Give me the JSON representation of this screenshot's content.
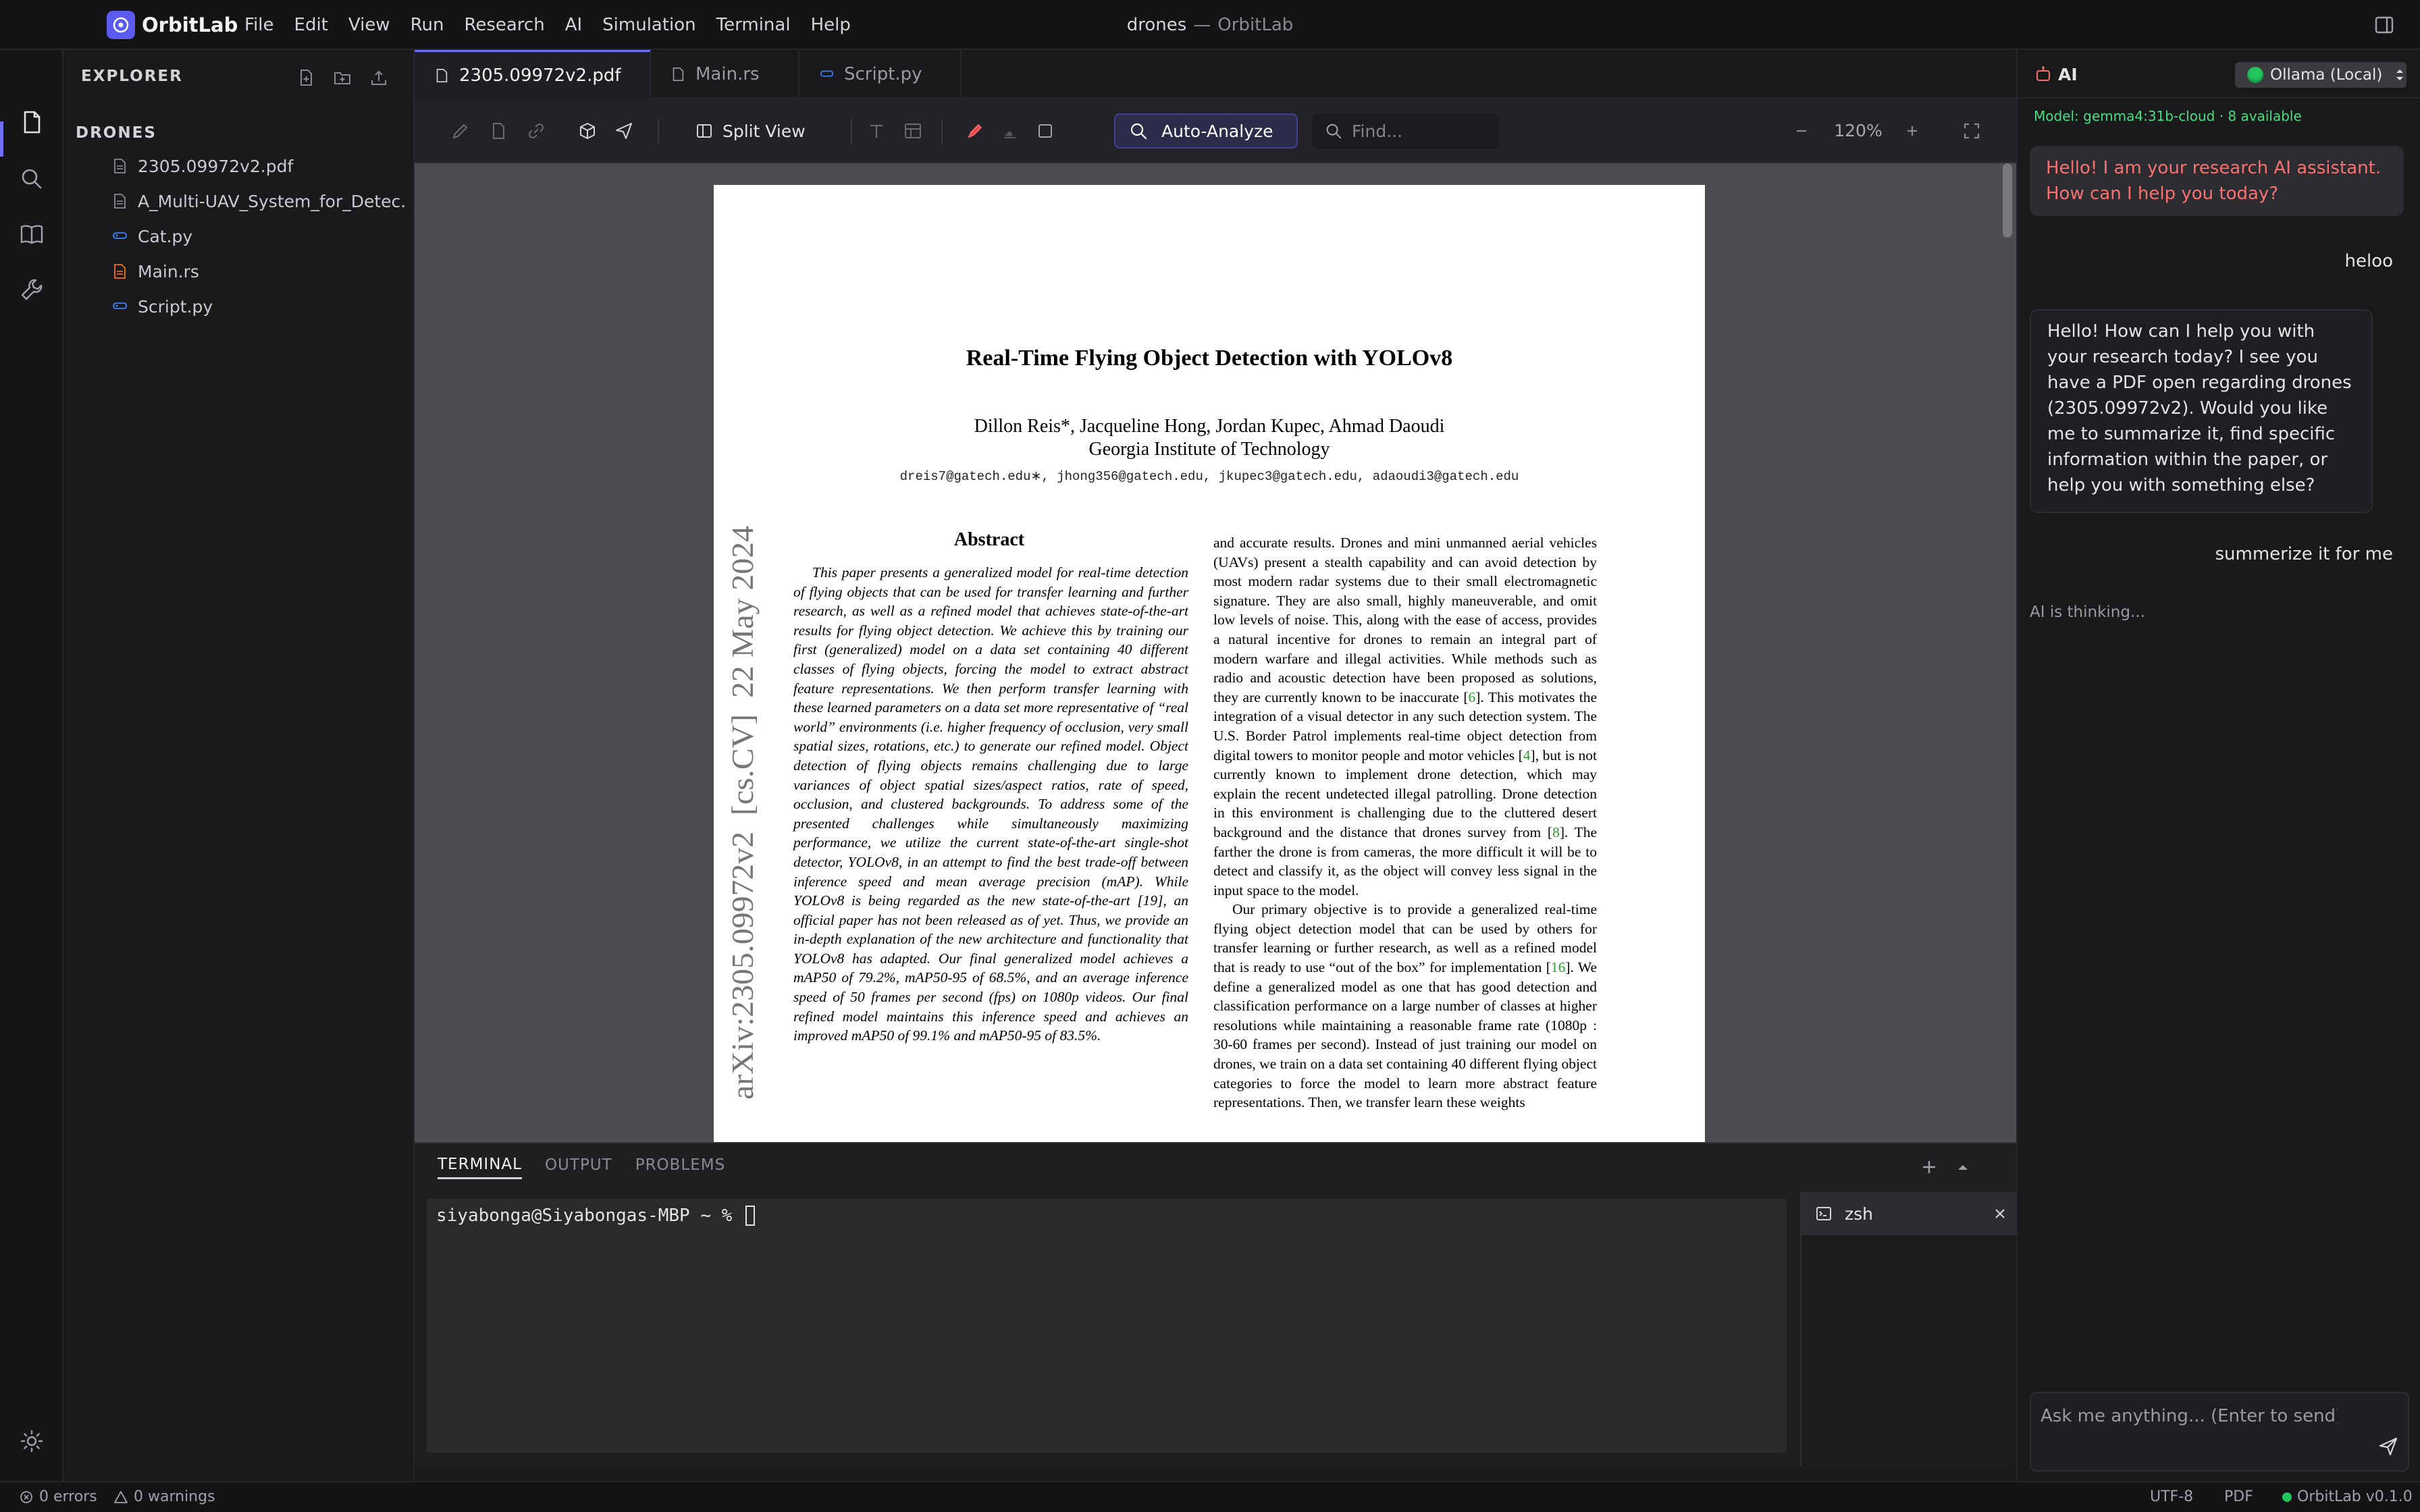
{
  "app": {
    "name": "OrbitLab",
    "project": "drones",
    "title_separator": "—"
  },
  "menu": [
    "File",
    "Edit",
    "View",
    "Run",
    "Research",
    "AI",
    "Simulation",
    "Terminal",
    "Help"
  ],
  "explorer": {
    "title": "EXPLORER",
    "folder": "DRONES",
    "files": [
      {
        "name": "2305.09972v2.pdf",
        "icon": "file-icon"
      },
      {
        "name": "A_Multi-UAV_System_for_Detec...",
        "icon": "file-icon"
      },
      {
        "name": "Cat.py",
        "icon": "python-icon"
      },
      {
        "name": "Main.rs",
        "icon": "rust-file-icon"
      },
      {
        "name": "Script.py",
        "icon": "python-icon"
      }
    ]
  },
  "tabs": [
    {
      "label": "2305.09972v2.pdf",
      "active": true
    },
    {
      "label": "Main.rs",
      "active": false
    },
    {
      "label": "Script.py",
      "active": false
    }
  ],
  "pdf_toolbar": {
    "split_view": "Split View",
    "auto_analyze": "Auto-Analyze",
    "find_placeholder": "Find...",
    "zoom": "120%"
  },
  "paper": {
    "title": "Real-Time Flying Object Detection with YOLOv8",
    "authors": "Dillon Reis*, Jacqueline Hong, Jordan Kupec, Ahmad Daoudi",
    "affiliation": "Georgia Institute of Technology",
    "emails": "dreis7@gatech.edu∗, jhong356@gatech.edu, jkupec3@gatech.edu, adaoudi3@gatech.edu",
    "arxiv_stamp": "arXiv:2305.09972v2  [cs.CV]  22 May 2024",
    "abstract_heading": "Abstract",
    "abstract": "This paper presents a generalized model for real-time detection of flying objects that can be used for transfer learning and further research, as well as a refined model that achieves state-of-the-art results for flying object detection. We achieve this by training our first (generalized) model on a data set containing 40 different classes of flying objects, forcing the model to extract abstract feature representations. We then perform transfer learning with these learned parameters on a data set more representative of “real world” environments (i.e. higher frequency of occlusion, very small spatial sizes, rotations, etc.) to generate our refined model. Object detection of flying objects remains challenging due to large variances of object spatial sizes/aspect ratios, rate of speed, occlusion, and clustered backgrounds. To address some of the presented challenges while simultaneously maximizing performance, we utilize the current state-of-the-art single-shot detector, YOLOv8, in an attempt to find the best trade-off between inference speed and mean average precision (mAP). While YOLOv8 is being regarded as the new state-of-the-art [19], an official paper has not been released as of yet. Thus, we provide an in-depth explanation of the new architecture and functionality that YOLOv8 has adapted. Our final generalized model achieves a mAP50 of 79.2%, mAP50-95 of 68.5%, and an average inference speed of 50 frames per second (fps) on 1080p videos. Our final refined model maintains this inference speed and achieves an improved mAP50 of 99.1% and mAP50-95 of 83.5%.",
    "right_p1_a": "and accurate results. Drones and mini unmanned aerial vehicles (UAVs) present a stealth capability and can avoid detection by most modern radar systems due to their small electromagnetic signature. They are also small, highly maneuverable, and omit low levels of noise. This, along with the ease of access, provides a natural incentive for drones to remain an integral part of modern warfare and illegal activities. While methods such as radio and acoustic detection have been proposed as solutions, they are currently known to be inaccurate [",
    "right_p1_c1": "6",
    "right_p1_b": "]. This motivates the integration of a visual detector in any such detection system. The U.S. Border Patrol implements real-time object detection from digital towers to monitor people and motor vehicles [",
    "right_p1_c2": "4",
    "right_p1_c": "], but is not currently known to implement drone detection, which may explain the recent undetected illegal patrolling. Drone detection in this environment is challenging due to the cluttered desert background and the distance that drones survey from [",
    "right_p1_c3": "8",
    "right_p1_d": "]. The farther the drone is from cameras, the more difficult it will be to detect and classify it, as the object will convey less signal in the input space to the model.",
    "right_p2_a": "Our primary objective is to provide a generalized real-time flying object detection model that can be used by others for transfer learning or further research, as well as a refined model that is ready to use “out of the box” for implementation [",
    "right_p2_c1": "16",
    "right_p2_b": "]. We define a generalized model as one that has good detection and classification performance on a large number of classes at higher resolutions while maintaining a reasonable frame rate (1080p : 30-60 frames per second). Instead of just training our model on drones, we train on a data set containing 40 different flying object categories to force the model to learn more abstract feature representations. Then, we transfer learn these weights"
  },
  "panel": {
    "tabs": [
      "TERMINAL",
      "OUTPUT",
      "PROBLEMS"
    ],
    "prompt": "siyabonga@Siyabongas-MBP ~ % ",
    "session": "zsh"
  },
  "ai": {
    "title": "AI",
    "model_select": "Ollama (Local)",
    "model_status": "Model: gemma4:31b-cloud · 8 available",
    "messages": [
      {
        "role": "assistant",
        "text": "Hello! I am your research AI assistant. How can I help you today?"
      },
      {
        "role": "user",
        "text": "heloo"
      },
      {
        "role": "assistant",
        "text": "Hello! How can I help you with your research today? I see you have a PDF open regarding drones (2305.09972v2). Would you like me to summarize it, find specific information within the paper, or help you with something else?"
      },
      {
        "role": "user",
        "text": "summerize it for me"
      }
    ],
    "thinking": "AI is thinking...",
    "input_placeholder": "Ask me anything... (Enter to send)"
  },
  "status": {
    "errors": "0 errors",
    "warnings": "0 warnings",
    "encoding": "UTF-8",
    "language": "PDF",
    "version": "OrbitLab v0.1.0"
  },
  "colors": {
    "accent": "#6d6df5",
    "ai_greeting": "#f87171",
    "model_ok": "#4ade80"
  }
}
